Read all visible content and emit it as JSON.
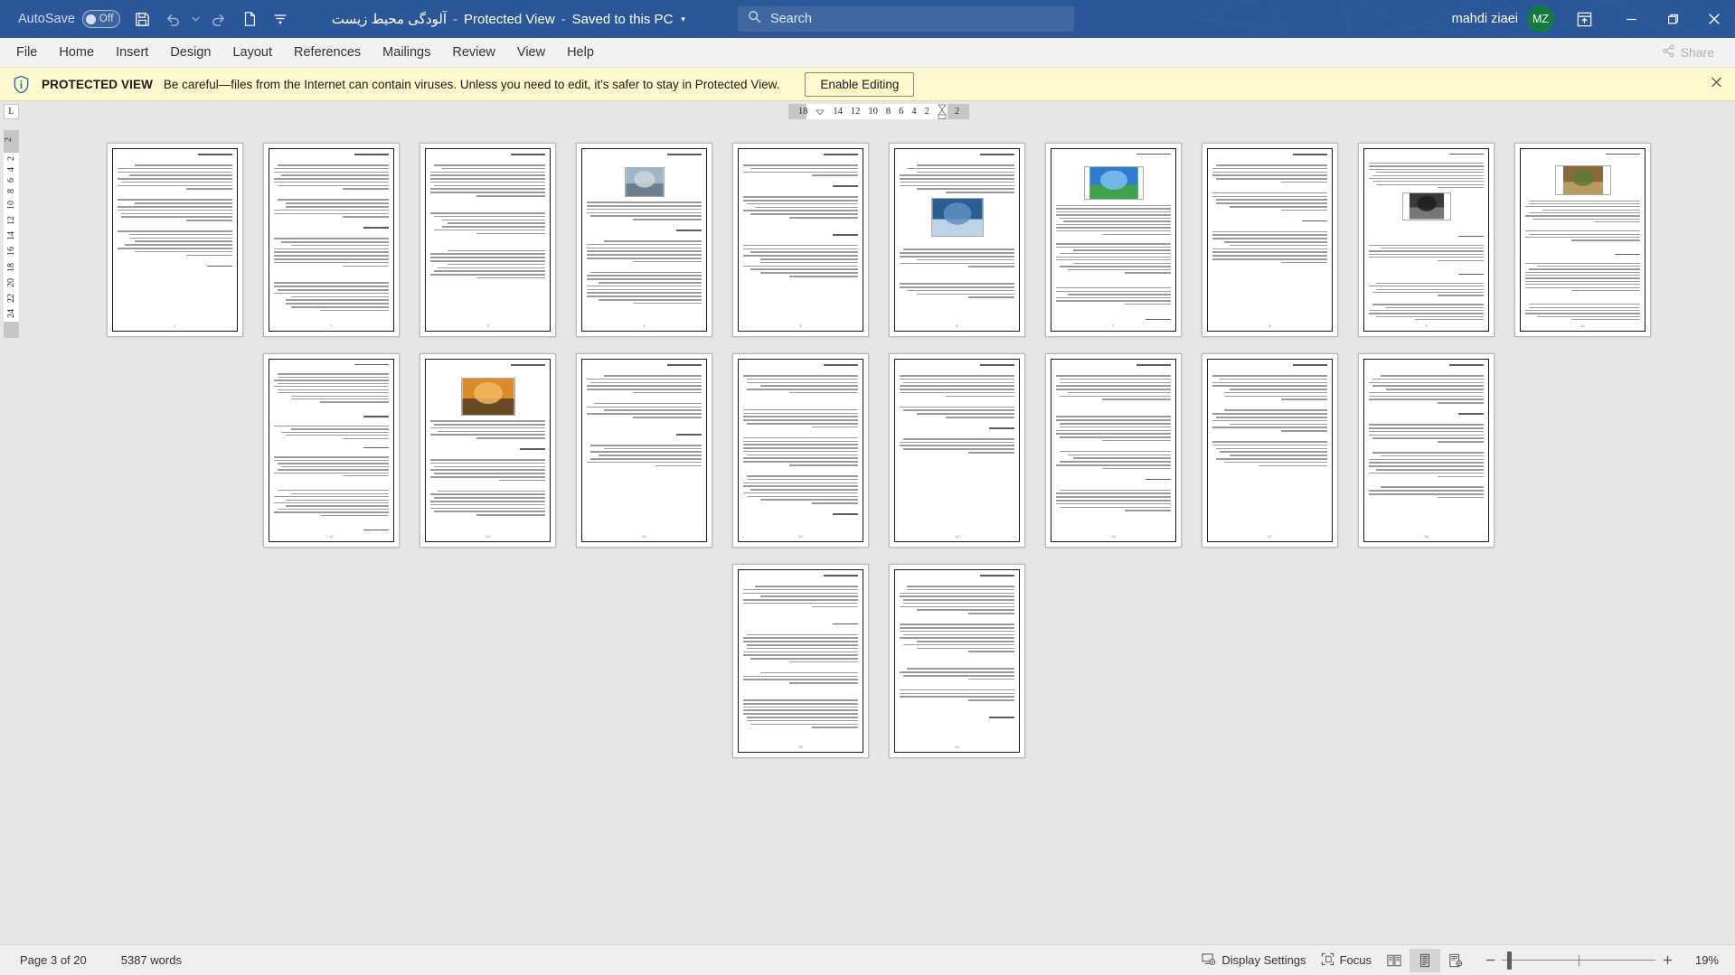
{
  "titlebar": {
    "autosave_label": "AutoSave",
    "autosave_state": "Off",
    "save_icon": "save-icon",
    "undo_icon": "undo-icon",
    "redo_icon": "redo-icon",
    "newdoc_icon": "new-document-icon",
    "customize_icon": "customize-quick-access-toolbar-icon",
    "doc_title": "آلودگی محیط زیست",
    "protected_view_label": "Protected View",
    "saved_label": "Saved to this PC",
    "sep": "-",
    "caret": "▾",
    "search_placeholder": "Search",
    "search_icon": "search-icon",
    "user_name": "mahdi ziaei",
    "avatar_initials": "MZ",
    "ribbon_display_icon": "ribbon-display-options-icon",
    "minimize": "—",
    "restore": "❐",
    "close": "✕",
    "bg_color": "#2b579a"
  },
  "ribbon": {
    "tabs": [
      {
        "label": "File"
      },
      {
        "label": "Home"
      },
      {
        "label": "Insert"
      },
      {
        "label": "Design"
      },
      {
        "label": "Layout"
      },
      {
        "label": "References"
      },
      {
        "label": "Mailings"
      },
      {
        "label": "Review"
      },
      {
        "label": "View"
      },
      {
        "label": "Help"
      }
    ],
    "share_label": "Share",
    "share_icon": "share-icon"
  },
  "protected_view": {
    "icon": "info-shield-icon",
    "strong": "PROTECTED VIEW",
    "message": "Be careful—files from the Internet can contain viruses. Unless you need to edit, it's safer to stay in Protected View.",
    "enable_button": "Enable Editing",
    "close_icon": "close-icon",
    "bg_color": "#fff8cc"
  },
  "ruler": {
    "corner_tab_marker": "L",
    "horizontal_numbers": [
      "18",
      "14",
      "12",
      "10",
      "8",
      "6",
      "4",
      "2",
      "2"
    ],
    "vertical_top_number": "2",
    "vertical_numbers": [
      "2",
      "4",
      "6",
      "8",
      "10",
      "12",
      "14",
      "16",
      "18",
      "20",
      "22",
      "24"
    ]
  },
  "statusbar": {
    "page_label": "Page 3 of 20",
    "word_count": "5387 words",
    "display_settings_label": "Display Settings",
    "display_settings_icon": "display-settings-icon",
    "focus_label": "Focus",
    "focus_icon": "focus-mode-icon",
    "view_read_icon": "read-mode-icon",
    "view_print_icon": "print-layout-icon",
    "view_web_icon": "web-layout-icon",
    "zoom_out_icon": "zoom-out-icon",
    "zoom_in_icon": "zoom-in-icon",
    "zoom_level": "19%"
  },
  "document": {
    "rows": [
      {
        "pages": [
          {
            "n": 1,
            "has_image": false,
            "image": null
          },
          {
            "n": 2,
            "has_image": false,
            "image": null
          },
          {
            "n": 3,
            "has_image": false,
            "image": null
          },
          {
            "n": 4,
            "has_image": true,
            "image": "city-street-photo"
          },
          {
            "n": 5,
            "has_image": false,
            "image": null
          },
          {
            "n": 6,
            "has_image": true,
            "image": "smokestack-photo"
          },
          {
            "n": 7,
            "has_image": true,
            "image": "earth-globe-graphic"
          },
          {
            "n": 8,
            "has_image": false,
            "image": null
          },
          {
            "n": 9,
            "has_image": true,
            "image": "dark-smoke-photo"
          },
          {
            "n": 10,
            "has_image": true,
            "image": "forest-and-map-photos"
          }
        ]
      },
      {
        "pages": [
          {
            "n": 11,
            "has_image": false,
            "image": null
          },
          {
            "n": 12,
            "has_image": true,
            "image": "sunset-city-photo"
          },
          {
            "n": 13,
            "has_image": false,
            "image": null
          },
          {
            "n": 14,
            "has_image": false,
            "image": null
          },
          {
            "n": 15,
            "has_image": false,
            "image": null
          },
          {
            "n": 16,
            "has_image": false,
            "image": null
          },
          {
            "n": 17,
            "has_image": false,
            "image": null
          },
          {
            "n": 18,
            "has_image": false,
            "image": null
          }
        ]
      },
      {
        "pages": [
          {
            "n": 19,
            "has_image": false,
            "image": null
          },
          {
            "n": 20,
            "has_image": false,
            "image": null
          }
        ]
      }
    ]
  }
}
